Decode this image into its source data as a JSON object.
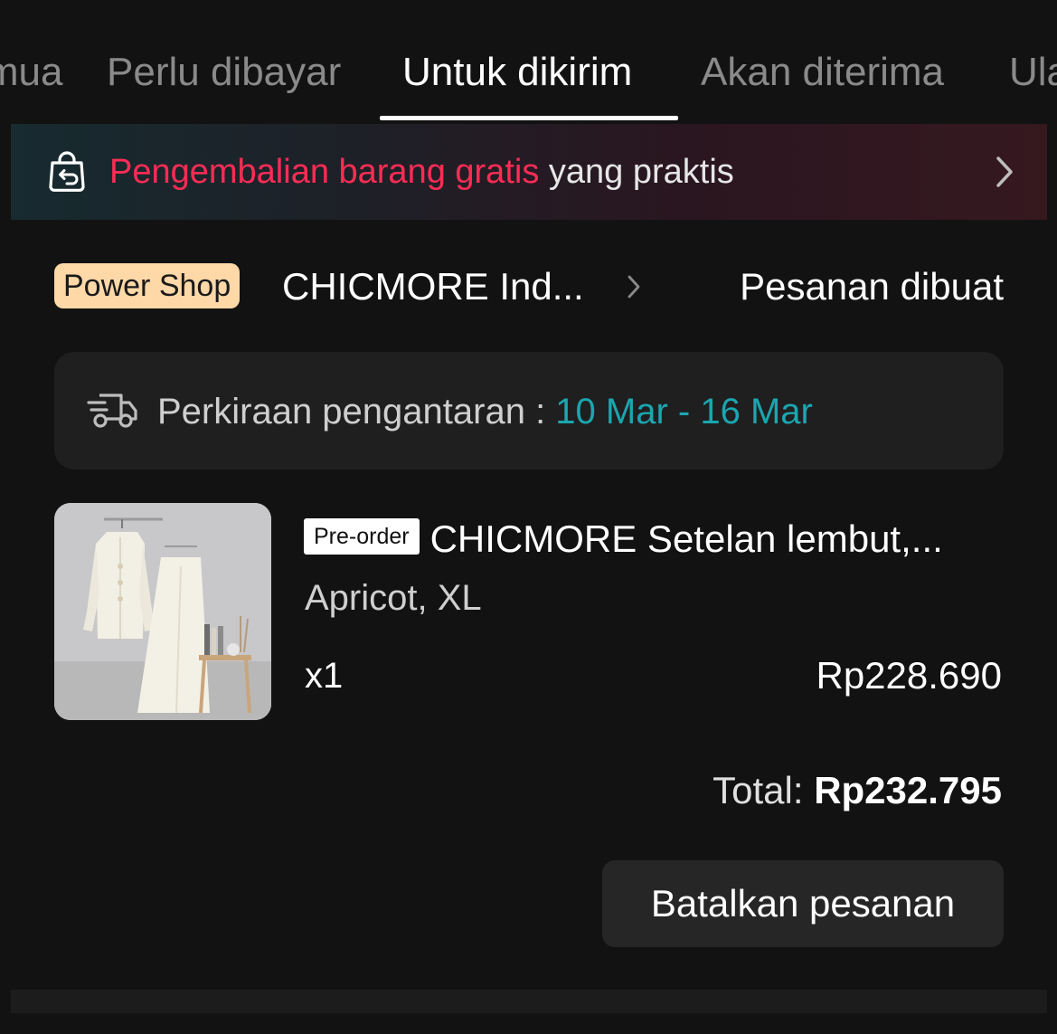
{
  "tabs": [
    {
      "label": "Semua",
      "active": false
    },
    {
      "label": "Perlu dibayar",
      "active": false
    },
    {
      "label": "Untuk dikirim",
      "active": true
    },
    {
      "label": "Akan diterima",
      "active": false
    },
    {
      "label": "Ulasan",
      "active": false
    }
  ],
  "banner": {
    "highlight": "Pengembalian barang gratis",
    "rest": " yang praktis",
    "icon": "return-bag-icon",
    "highlight_color": "#fe2c55"
  },
  "shop": {
    "badge": "Power Shop",
    "name": "CHICMORE Ind...",
    "status": "Pesanan dibuat"
  },
  "delivery": {
    "label": "Perkiraan pengantaran : ",
    "date": "10 Mar - 16 Mar",
    "icon": "delivery-truck-icon",
    "date_color": "#1ba6b0"
  },
  "product": {
    "badge": "Pre-order",
    "title": "CHICMORE Setelan lembut,...",
    "variant": "Apricot, XL",
    "quantity": "x1",
    "price": "Rp228.690"
  },
  "total": {
    "label": "Total: ",
    "value": "Rp232.795"
  },
  "actions": {
    "cancel_label": "Batalkan pesanan"
  }
}
